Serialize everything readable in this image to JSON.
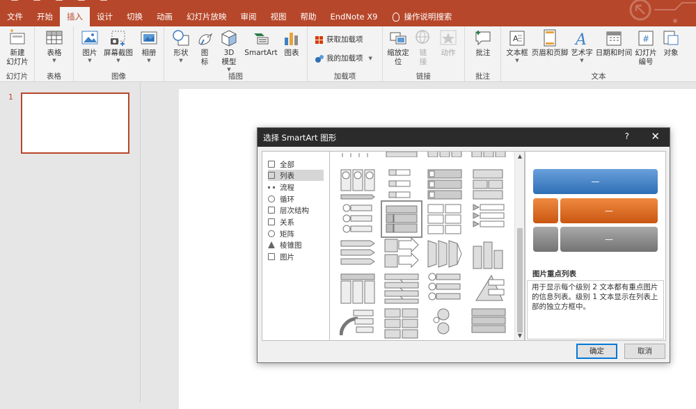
{
  "tabs": [
    "文件",
    "开始",
    "插入",
    "设计",
    "切换",
    "动画",
    "幻灯片放映",
    "审阅",
    "视图",
    "帮助",
    "EndNote X9"
  ],
  "active_tab": "插入",
  "tell_me": "操作说明搜索",
  "ribbon": {
    "new_slide": "新建\n幻灯片",
    "slides_group": "幻灯片",
    "table": "表格",
    "table_group": "表格",
    "picture": "图片",
    "screenshot": "屏幕截图",
    "album": "相册",
    "images_group": "图像",
    "shapes": "形状",
    "icons": "图\n标",
    "model3d": "3D\n模型",
    "smartart": "SmartArt",
    "chart": "图表",
    "illustrations_group": "插图",
    "get_addins": "获取加载项",
    "my_addins": "我的加载项",
    "addins_group": "加载项",
    "zoom": "缩放定\n位",
    "link": "链\n接",
    "action": "动作",
    "links_group": "链接",
    "comment": "批注",
    "comments_group": "批注",
    "textbox": "文本框",
    "header_footer": "页眉和页脚",
    "wordart": "艺术字",
    "datetime": "日期和时间",
    "slide_number": "幻灯片\n编号",
    "object": "对象",
    "text_group": "文本"
  },
  "slide_thumb_number": "1",
  "dialog": {
    "title": "选择 SmartArt 图形",
    "help": "?",
    "close": "✕",
    "categories": [
      "全部",
      "列表",
      "流程",
      "循环",
      "层次结构",
      "关系",
      "矩阵",
      "棱锥图",
      "图片"
    ],
    "selected_category": "列表",
    "preview_title": "图片重点列表",
    "preview_desc": "用于显示每个级别 2 文本都有重点图片的信息列表。级别 1 文本显示在列表上部的独立方框中。",
    "preview_dash": "—",
    "ok": "确定",
    "cancel": "取消"
  },
  "colors": {
    "accent": "#b7472a",
    "blue": "#3f7fc4",
    "orange": "#e06b1f",
    "gray": "#8a8a8a"
  }
}
